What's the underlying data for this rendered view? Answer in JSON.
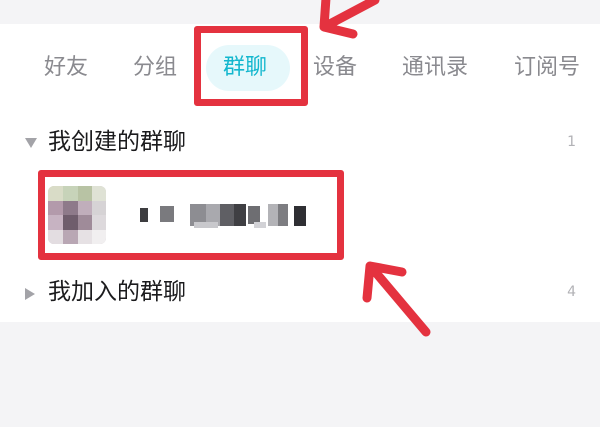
{
  "tabs": {
    "friends": "好友",
    "groups": "分组",
    "group_chats": "群聊",
    "devices": "设备",
    "contacts": "通讯录",
    "subscriptions": "订阅号"
  },
  "created_groups": {
    "title": "我创建的群聊",
    "count": "1"
  },
  "joined_groups": {
    "title": "我加入的群聊",
    "count": "4"
  },
  "colors": {
    "active_tab": "#13b7ce",
    "active_tab_bg": "#e6f8fb",
    "annotation_red": "#e4323f"
  },
  "icons": {
    "expanded": "caret-down-icon",
    "collapsed": "caret-right-icon"
  }
}
